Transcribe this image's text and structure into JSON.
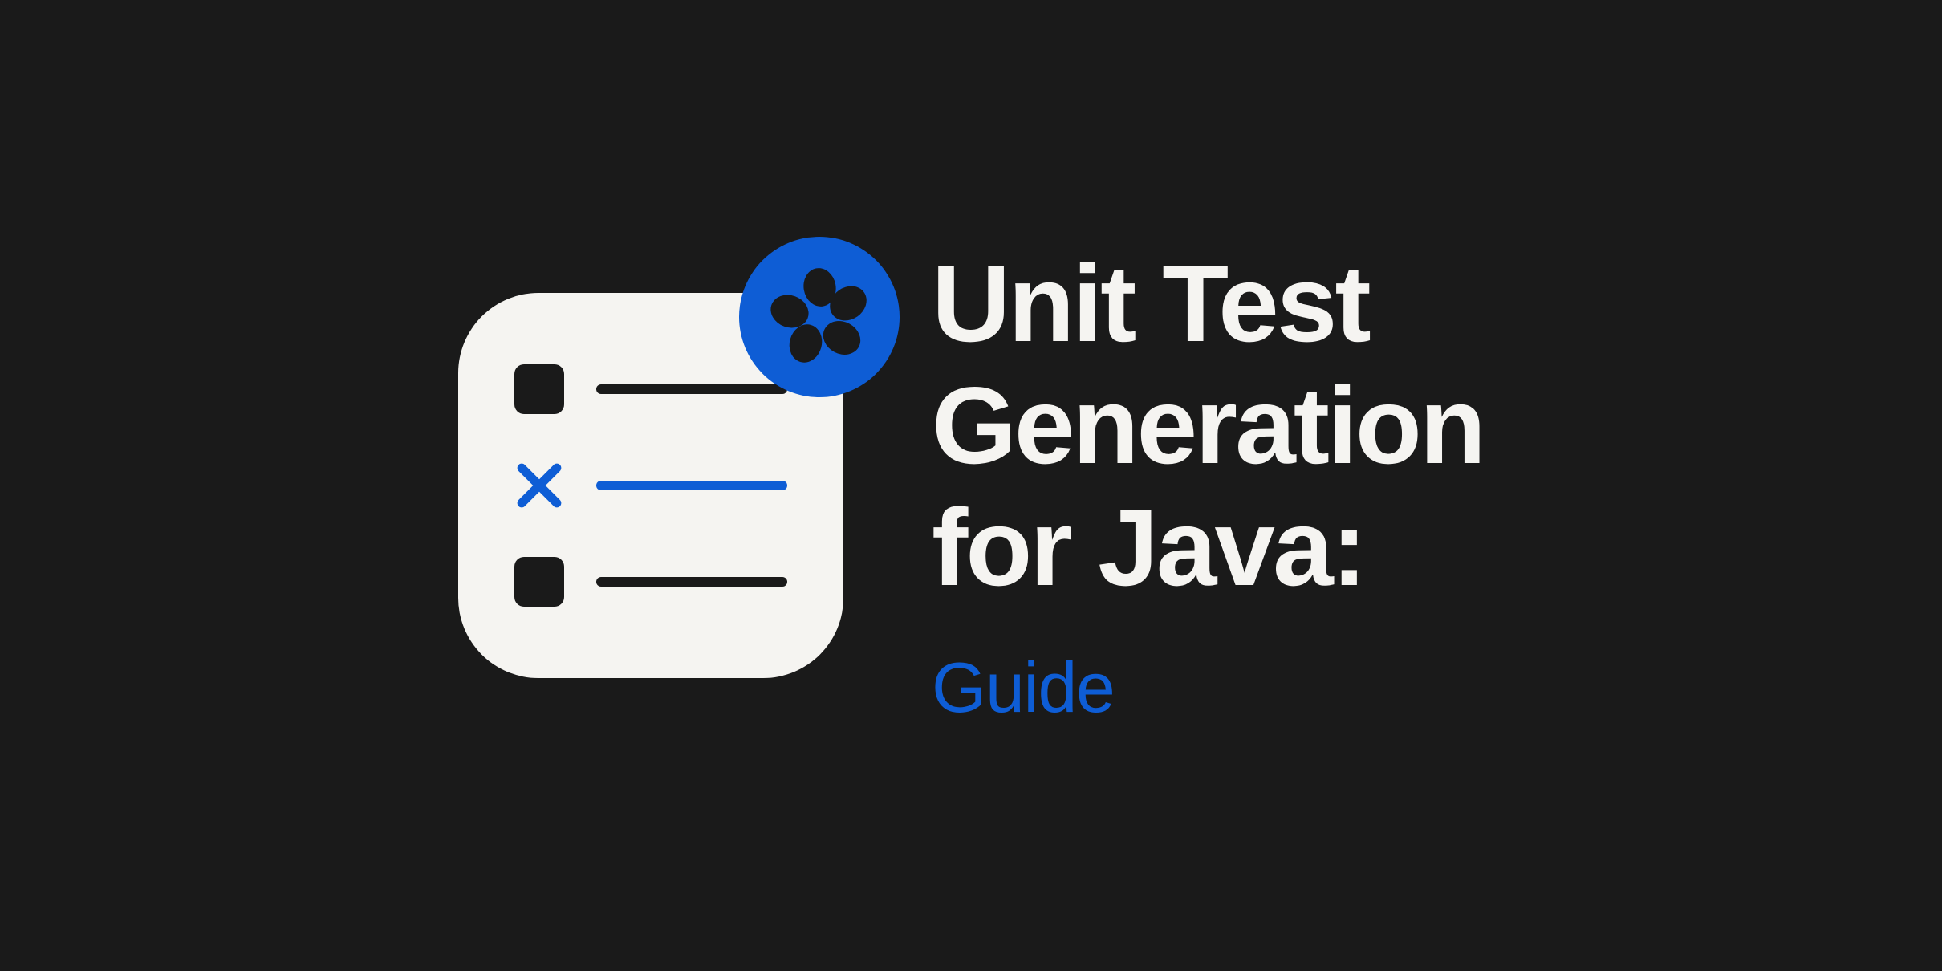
{
  "heading": "Unit Test\nGeneration\nfor Java:",
  "subheading": "Guide",
  "colors": {
    "background": "#1a1a1a",
    "cardBackground": "#f5f4f1",
    "accent": "#0e5dd5",
    "textPrimary": "#f5f4f1",
    "iconDark": "#1a1a1a"
  },
  "icon": {
    "type": "checklist",
    "badge": "flower-logo"
  }
}
